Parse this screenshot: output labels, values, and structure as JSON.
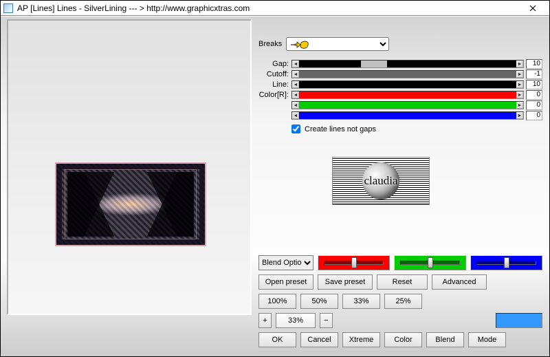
{
  "window": {
    "title": "AP [Lines]  Lines - SilverLining   --- > http://www.graphicxtras.com"
  },
  "breaks": {
    "label": "Breaks",
    "selected": ""
  },
  "sliders": {
    "gap": {
      "label": "Gap:",
      "value": "10"
    },
    "cutoff": {
      "label": "Cutoff:",
      "value": "-1"
    },
    "line": {
      "label": "Line:",
      "value": "10"
    },
    "color": {
      "label": "Color[R]:",
      "r": "0",
      "g": "0",
      "b": "0"
    }
  },
  "checkbox": {
    "label": "Create lines not gaps",
    "checked": true
  },
  "logo": {
    "text": "claudia"
  },
  "blendopt": {
    "label": "Blend Options"
  },
  "rgb": {
    "r": 128,
    "g": 128,
    "b": 128
  },
  "buttons": {
    "open": "Open preset",
    "save": "Save preset",
    "reset": "Reset",
    "advanced": "Advanced",
    "p100": "100%",
    "p50": "50%",
    "p33": "33%",
    "p25": "25%",
    "plus": "+",
    "minus": "−",
    "ok": "OK",
    "cancel": "Cancel",
    "xtreme": "Xtreme",
    "color": "Color",
    "blend": "Blend",
    "mode": "Mode"
  },
  "zoom": {
    "value": "33%"
  },
  "swatch": {
    "hex": "#3399ff"
  }
}
